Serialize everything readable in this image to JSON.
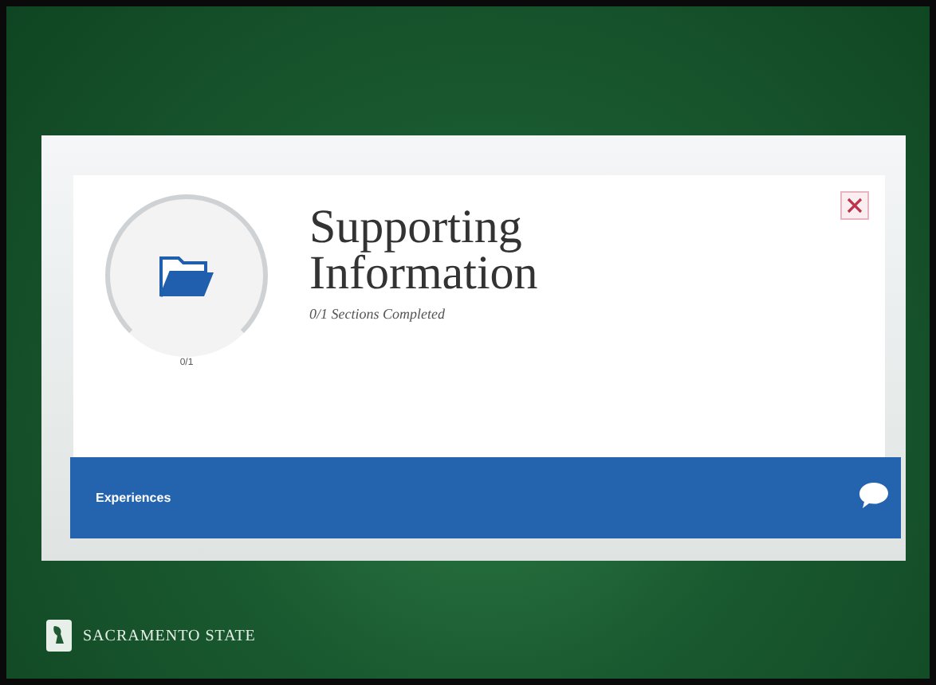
{
  "card": {
    "title": "Supporting Information",
    "subtitle": "0/1 Sections Completed",
    "ring_label": "0/1"
  },
  "section_bar": {
    "label": "Experiences"
  },
  "footer": {
    "logo_text": "SACRAMENTO STATE"
  }
}
